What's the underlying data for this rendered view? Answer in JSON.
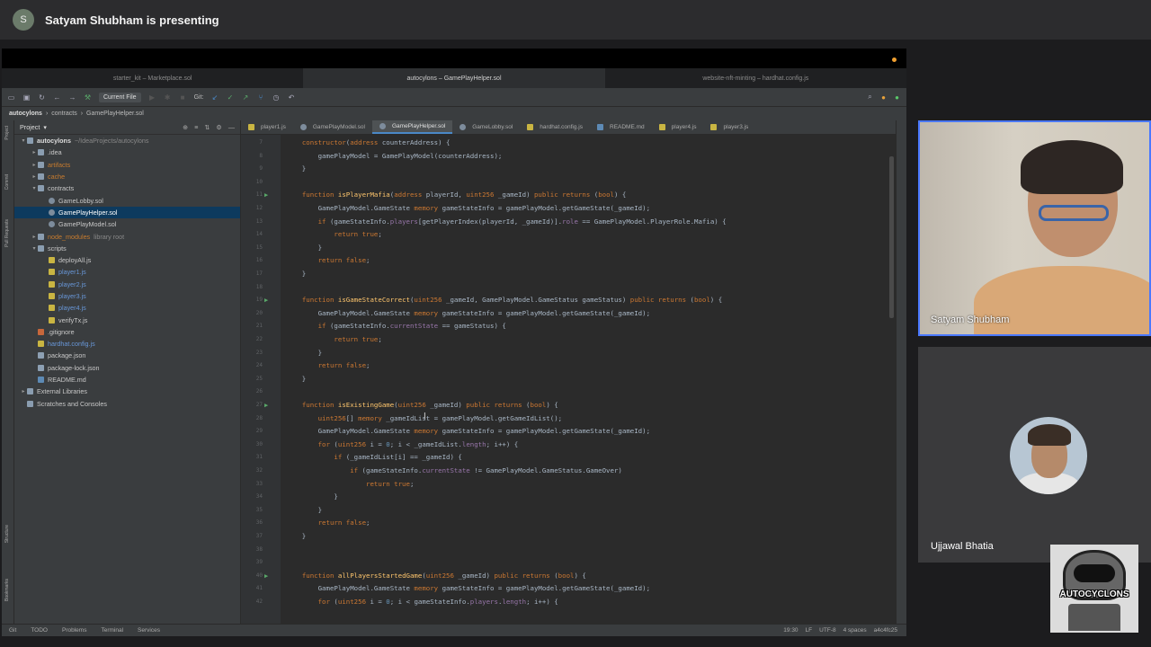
{
  "meeting": {
    "presenting_label": "Satyam Shubham is presenting",
    "presenter_initial": "S"
  },
  "ide": {
    "window_tabs": [
      "starter_kit – Marketplace.sol",
      "autocylons – GamePlayHelper.sol",
      "website-nft-minting – hardhat.config.js"
    ],
    "toolbar": {
      "run_config": "Current File",
      "git_label": "Git:"
    },
    "breadcrumbs": [
      "autocylons",
      "contracts",
      "GamePlayHelper.sol"
    ],
    "project_label": "Project",
    "tree": [
      {
        "label": "autocylons",
        "suffix": "~/IdeaProjects/autocylons",
        "indent": 0,
        "icon": "fold",
        "arrow": "▾",
        "color": "#dddddd"
      },
      {
        "label": ".idea",
        "indent": 1,
        "icon": "fold",
        "arrow": "▸",
        "color": "#c8c8c8"
      },
      {
        "label": "artifacts",
        "indent": 1,
        "icon": "fold",
        "arrow": "▸",
        "color": "#c77b2e"
      },
      {
        "label": "cache",
        "indent": 1,
        "icon": "fold",
        "arrow": "▸",
        "color": "#c77b2e"
      },
      {
        "label": "contracts",
        "indent": 1,
        "icon": "fold",
        "arrow": "▾",
        "color": "#c8c8c8"
      },
      {
        "label": "GameLobby.sol",
        "indent": 2,
        "icon": "sol",
        "arrow": "",
        "color": "#c8c8c8"
      },
      {
        "label": "GamePlayHelper.sol",
        "indent": 2,
        "icon": "sol",
        "arrow": "",
        "color": "#ffffff",
        "selected": true
      },
      {
        "label": "GamePlayModel.sol",
        "indent": 2,
        "icon": "sol",
        "arrow": "",
        "color": "#c8c8c8"
      },
      {
        "label": "node_modules",
        "suffix": "library root",
        "indent": 1,
        "icon": "fold",
        "arrow": "▸",
        "color": "#c77b2e"
      },
      {
        "label": "scripts",
        "indent": 1,
        "icon": "fold",
        "arrow": "▾",
        "color": "#c8c8c8"
      },
      {
        "label": "deployAll.js",
        "indent": 2,
        "icon": "js",
        "arrow": "",
        "color": "#c8c8c8"
      },
      {
        "label": "player1.js",
        "indent": 2,
        "icon": "js",
        "arrow": "",
        "color": "#6897d8"
      },
      {
        "label": "player2.js",
        "indent": 2,
        "icon": "js",
        "arrow": "",
        "color": "#6897d8"
      },
      {
        "label": "player3.js",
        "indent": 2,
        "icon": "js",
        "arrow": "",
        "color": "#6897d8"
      },
      {
        "label": "player4.js",
        "indent": 2,
        "icon": "js",
        "arrow": "",
        "color": "#6897d8"
      },
      {
        "label": "verifyTx.js",
        "indent": 2,
        "icon": "js",
        "arrow": "",
        "color": "#c8c8c8"
      },
      {
        "label": ".gitignore",
        "indent": 1,
        "icon": "git",
        "arrow": "",
        "color": "#c8c8c8"
      },
      {
        "label": "hardhat.config.js",
        "indent": 1,
        "icon": "js",
        "arrow": "",
        "color": "#6897d8"
      },
      {
        "label": "package.json",
        "indent": 1,
        "icon": "json",
        "arrow": "",
        "color": "#c8c8c8"
      },
      {
        "label": "package-lock.json",
        "indent": 1,
        "icon": "json",
        "arrow": "",
        "color": "#c8c8c8"
      },
      {
        "label": "README.md",
        "indent": 1,
        "icon": "md",
        "arrow": "",
        "color": "#c8c8c8"
      },
      {
        "label": "External Libraries",
        "indent": 0,
        "icon": "fold",
        "arrow": "▸",
        "color": "#c8c8c8"
      },
      {
        "label": "Scratches and Consoles",
        "indent": 0,
        "icon": "fold",
        "arrow": "",
        "color": "#c8c8c8"
      }
    ],
    "editor_tabs": [
      {
        "label": "player1.js",
        "active": false
      },
      {
        "label": "GamePlayModel.sol",
        "active": false
      },
      {
        "label": "GamePlayHelper.sol",
        "active": true
      },
      {
        "label": "GameLobby.sol",
        "active": false
      },
      {
        "label": "hardhat.config.js",
        "active": false
      },
      {
        "label": "README.md",
        "active": false
      },
      {
        "label": "player4.js",
        "active": false
      },
      {
        "label": "player3.js",
        "active": false
      }
    ],
    "code_lines": [
      {
        "n": "7",
        "t": "    constructor(address counterAddress) {"
      },
      {
        "n": "8",
        "t": "        gamePlayModel = GamePlayModel(counterAddress);"
      },
      {
        "n": "9",
        "t": "    }"
      },
      {
        "n": "10",
        "t": ""
      },
      {
        "n": "11",
        "t": "    function isPlayerMafia(address playerId, uint256 _gameId) public returns (bool) {",
        "run": true
      },
      {
        "n": "12",
        "t": "        GamePlayModel.GameState memory gameStateInfo = gamePlayModel.getGameState(_gameId);"
      },
      {
        "n": "13",
        "t": "        if (gameStateInfo.players[getPlayerIndex(playerId, _gameId)].role == GamePlayModel.PlayerRole.Mafia) {"
      },
      {
        "n": "14",
        "t": "            return true;"
      },
      {
        "n": "15",
        "t": "        }"
      },
      {
        "n": "16",
        "t": "        return false;"
      },
      {
        "n": "17",
        "t": "    }"
      },
      {
        "n": "18",
        "t": ""
      },
      {
        "n": "19",
        "t": "    function isGameStateCorrect(uint256 _gameId, GamePlayModel.GameStatus gameStatus) public returns (bool) {",
        "run": true
      },
      {
        "n": "20",
        "t": "        GamePlayModel.GameState memory gameStateInfo = gamePlayModel.getGameState(_gameId);"
      },
      {
        "n": "21",
        "t": "        if (gameStateInfo.currentState == gameStatus) {"
      },
      {
        "n": "22",
        "t": "            return true;"
      },
      {
        "n": "23",
        "t": "        }"
      },
      {
        "n": "24",
        "t": "        return false;"
      },
      {
        "n": "25",
        "t": "    }"
      },
      {
        "n": "26",
        "t": ""
      },
      {
        "n": "27",
        "t": "    function isExistingGame(uint256 _gameId) public returns (bool) {",
        "run": true
      },
      {
        "n": "28",
        "t": "        uint256[] memory _gameIdList = gamePlayModel.getGameIdList();"
      },
      {
        "n": "29",
        "t": "        GamePlayModel.GameState memory gameStateInfo = gamePlayModel.getGameState(_gameId);"
      },
      {
        "n": "30",
        "t": "        for (uint256 i = 0; i < _gameIdList.length; i++) {"
      },
      {
        "n": "31",
        "t": "            if (_gameIdList[i] == _gameId) {"
      },
      {
        "n": "32",
        "t": "                if (gameStateInfo.currentState != GamePlayModel.GameStatus.GameOver)"
      },
      {
        "n": "33",
        "t": "                    return true;"
      },
      {
        "n": "34",
        "t": "            }"
      },
      {
        "n": "35",
        "t": "        }"
      },
      {
        "n": "36",
        "t": "        return false;"
      },
      {
        "n": "37",
        "t": "    }"
      },
      {
        "n": "38",
        "t": ""
      },
      {
        "n": "39",
        "t": ""
      },
      {
        "n": "40",
        "t": "    function allPlayersStartedGame(uint256 _gameId) public returns (bool) {",
        "run": true
      },
      {
        "n": "41",
        "t": "        GamePlayModel.GameState memory gameStateInfo = gamePlayModel.getGameState(_gameId);"
      },
      {
        "n": "42",
        "t": "        for (uint256 i = 0; i < gameStateInfo.players.length; i++) {"
      }
    ],
    "status_bar": {
      "left": [
        "Git",
        "TODO",
        "Problems",
        "Terminal",
        "Services"
      ],
      "right": [
        "19:30",
        "LF",
        "UTF-8",
        "4 spaces",
        "a4c4fc25"
      ]
    }
  },
  "participants": {
    "presenter_name": "Satyam Shubham",
    "second_name": "Ujjawal Bhatia",
    "logo_text": "AUTOCYCLONS"
  }
}
